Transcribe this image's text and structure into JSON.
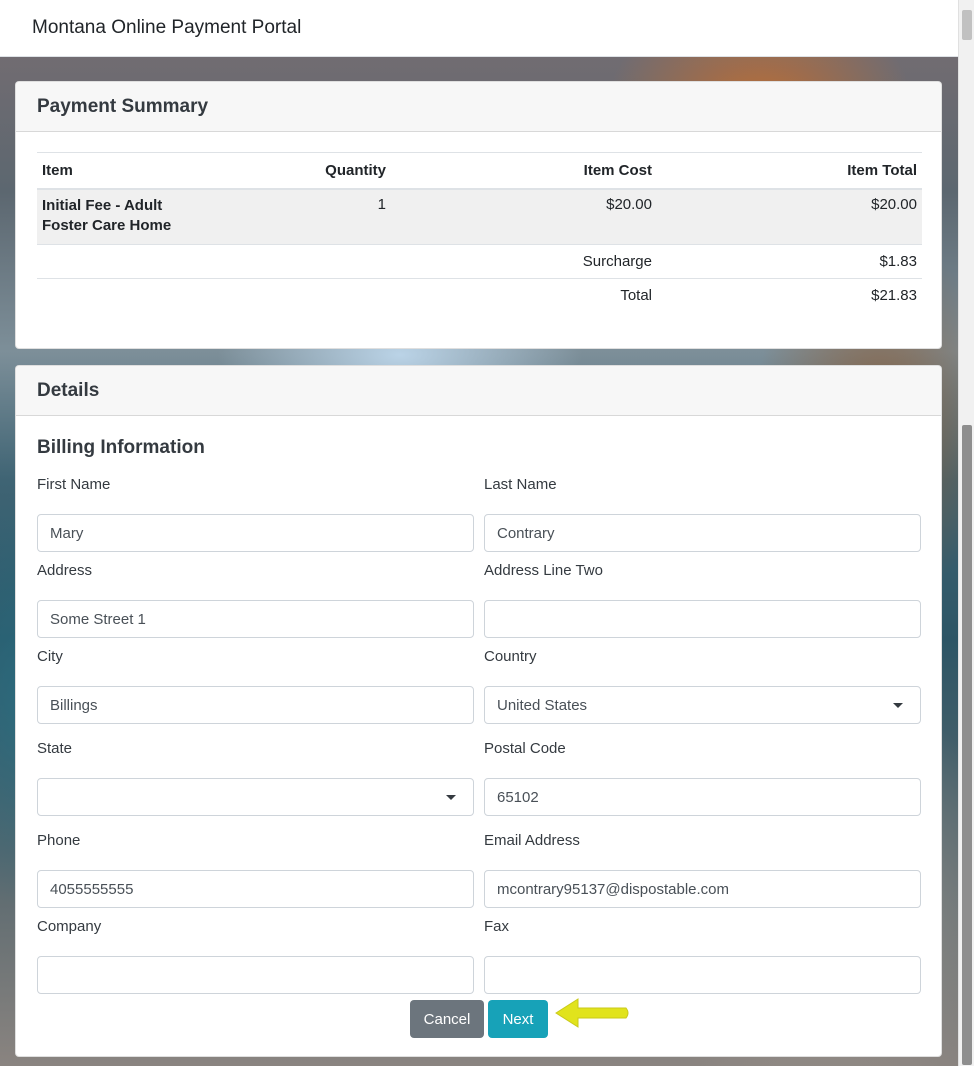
{
  "header": {
    "title": "Montana Online Payment Portal"
  },
  "summary": {
    "title": "Payment Summary",
    "columns": [
      "Item",
      "Quantity",
      "Item Cost",
      "Item Total"
    ],
    "items": [
      {
        "name_line1": "Initial Fee - Adult",
        "name_line2": "Foster Care Home",
        "quantity": "1",
        "cost": "$20.00",
        "total": "$20.00"
      }
    ],
    "surcharge_label": "Surcharge",
    "surcharge_value": "$1.83",
    "total_label": "Total",
    "total_value": "$21.83"
  },
  "details": {
    "title": "Details",
    "section": "Billing Information",
    "fields": {
      "first_name": {
        "label": "First Name",
        "value": "Mary"
      },
      "last_name": {
        "label": "Last Name",
        "value": "Contrary"
      },
      "address": {
        "label": "Address",
        "value": "Some Street 1"
      },
      "address2": {
        "label": "Address Line Two",
        "value": ""
      },
      "city": {
        "label": "City",
        "value": "Billings"
      },
      "country": {
        "label": "Country",
        "value": "United States"
      },
      "state": {
        "label": "State",
        "value": ""
      },
      "postal": {
        "label": "Postal Code",
        "value": "65102"
      },
      "phone": {
        "label": "Phone",
        "value": "4055555555"
      },
      "email": {
        "label": "Email Address",
        "value": "mcontrary95137@dispostable.com"
      },
      "company": {
        "label": "Company",
        "value": ""
      },
      "fax": {
        "label": "Fax",
        "value": ""
      }
    },
    "buttons": {
      "cancel": "Cancel",
      "next": "Next"
    }
  },
  "colors": {
    "next_button": "#17a2b8",
    "cancel_button": "#6c757d",
    "annotation_arrow": "#e1e31c"
  },
  "icons": {
    "annotation": "arrow-left-icon",
    "dropdown": "caret-down-icon"
  }
}
